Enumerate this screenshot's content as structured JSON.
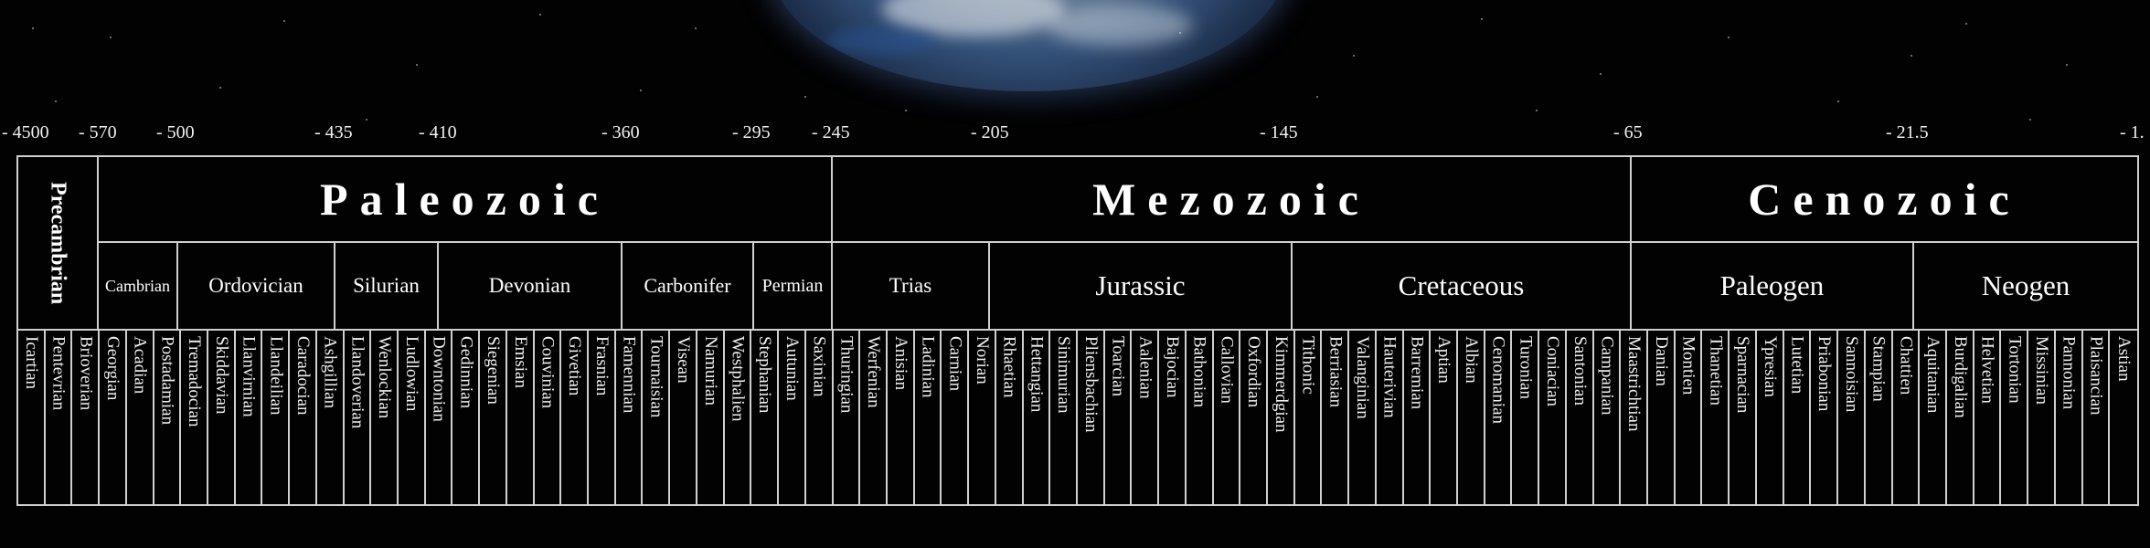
{
  "time_ticks": [
    "- 4500",
    "- 570",
    "- 500",
    "- 435",
    "- 410",
    "- 360",
    "- 295",
    "- 245",
    "- 205",
    "- 145",
    "- 65",
    "- 21.5",
    "- 1."
  ],
  "precambrian": "Precambrian",
  "eras": [
    "Paleozoic",
    "Mezozoic",
    "Cenozoic"
  ],
  "periods": [
    "Cambrian",
    "Ordovician",
    "Silurian",
    "Devonian",
    "Carbonifer",
    "Permian",
    "Trias",
    "Jurassic",
    "Cretaceous",
    "Paleogen",
    "Neogen"
  ],
  "stages": [
    "Icartian",
    "Pentevrian",
    "Brioverian",
    "Georgian",
    "Acadian",
    "Postadamian",
    "Tremadocian",
    "Skiddavian",
    "Llanvirnian",
    "Llandeilian",
    "Caradocian",
    "Ashgillian",
    "Llandoverian",
    "Wenlockian",
    "Ludlowian",
    "Downtonian",
    "Gedinnian",
    "Siegenian",
    "Emsian",
    "Couvinian",
    "Givetian",
    "Frasnian",
    "Famennian",
    "Tournaisian",
    "Visean",
    "Namurian",
    "Westphalien",
    "Stephanian",
    "Autunian",
    "Saxinian",
    "Thuringian",
    "Werfenian",
    "Anisian",
    "Ladinian",
    "Carnian",
    "Norian",
    "Rhaetian",
    "Hettangian",
    "Sinimurian",
    "Pliensbachian",
    "Toarcian",
    "Aalenian",
    "Bajocian",
    "Bathonian",
    "Callovian",
    "Oxfordian",
    "Kimmerdgian",
    "Tithonic",
    "Berriasian",
    "Valanginian",
    "Hauterivian",
    "Barremian",
    "Aptian",
    "Albian",
    "Cenomanian",
    "Turonian",
    "Coniacian",
    "Santonian",
    "Campanian",
    "Maastrichtian",
    "Danian",
    "Montien",
    "Thanetian",
    "Sparnacian",
    "Ypresian",
    "Lutetian",
    "Priabonian",
    "Sannoisian",
    "Stampian",
    "Chattien",
    "Aquitanian",
    "Burdigalian",
    "Helvetian",
    "Tortonian",
    "Missinian",
    "Pannonian",
    "Plaisancian",
    "Astian"
  ]
}
